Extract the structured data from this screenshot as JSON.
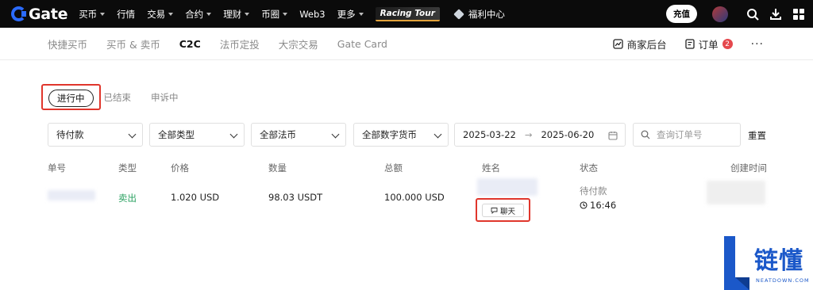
{
  "topbar": {
    "logo_text": "Gate",
    "nav": [
      {
        "label": "买币",
        "dropdown": true
      },
      {
        "label": "行情",
        "dropdown": false
      },
      {
        "label": "交易",
        "dropdown": true
      },
      {
        "label": "合约",
        "dropdown": true
      },
      {
        "label": "理财",
        "dropdown": true
      },
      {
        "label": "币圈",
        "dropdown": true
      },
      {
        "label": "Web3",
        "dropdown": false
      },
      {
        "label": "更多",
        "dropdown": true
      }
    ],
    "racing_label": "Racing Tour",
    "welfare_label": "福利中心",
    "deposit_label": "充值",
    "icons": [
      "search-icon",
      "download-icon",
      "apps-grid-icon"
    ]
  },
  "subnav": {
    "tabs": [
      "快捷买币",
      "买币 & 卖币",
      "C2C",
      "法币定投",
      "大宗交易",
      "Gate Card"
    ],
    "active_tab": "C2C",
    "merchant_label": "商家后台",
    "orders_label": "订单",
    "orders_badge": "2",
    "more_label": "···"
  },
  "status_tabs": {
    "in_progress": "进行中",
    "ended": "已结束",
    "appeal": "申诉中"
  },
  "filters": {
    "status": "待付款",
    "type": "全部类型",
    "fiat": "全部法币",
    "crypto": "全部数字货币",
    "date_from": "2025-03-22",
    "date_to": "2025-06-20",
    "date_arrow": "→",
    "search_placeholder": "查询订单号",
    "reset_label": "重置"
  },
  "table": {
    "headers": {
      "order_no": "单号",
      "type": "类型",
      "price": "价格",
      "quantity": "数量",
      "total": "总额",
      "name": "姓名",
      "status": "状态",
      "created": "创建时间"
    },
    "row": {
      "type": "卖出",
      "price": "1.020 USD",
      "quantity": "98.03 USDT",
      "total": "100.000 USD",
      "chat_label": "聊天",
      "status": "待付款",
      "countdown": "16:46"
    }
  },
  "watermark": {
    "text": "链懂",
    "sub": "NEATDOWN.COM"
  },
  "colors": {
    "accent_blue": "#2b6bff",
    "highlight_red": "#e0362c",
    "sell_green": "#2aa160",
    "badge_red": "#e5484d",
    "watermark_blue": "#1b58c9"
  }
}
